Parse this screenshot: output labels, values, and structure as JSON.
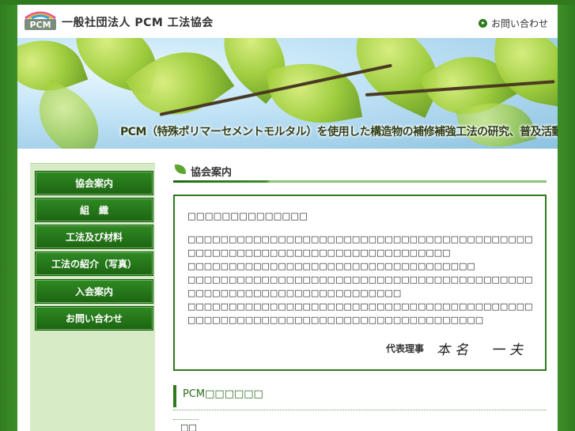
{
  "header": {
    "logo_text": "PCM",
    "site_title": "一般社団法人 PCM 工法協会",
    "contact_label": "お問い合わせ"
  },
  "banner": {
    "tagline": "PCM（特殊ポリマーセメントモルタル）を使用した構造物の補修補強工法の研究、普及活動"
  },
  "sidebar": {
    "items": [
      {
        "label": "協会案内"
      },
      {
        "label": "組　織"
      },
      {
        "label": "工法及び材料"
      },
      {
        "label": "工法の紹介（写真）"
      },
      {
        "label": "入会案内"
      },
      {
        "label": "お問い合わせ"
      }
    ]
  },
  "main": {
    "heading": "協会案内",
    "greeting_title": "□□□□□□□□□□□□□□",
    "paragraphs": [
      "□□□□□□□□□□□□□□□□□□□□□□□□□□□□□□□□□□□□□□□□□□□□□□□□□□□□□□□□□□□□□□□□□□□□□□□□□□",
      "□□□□□□□□□□□□□□□□□□□□□□□□□□□□□□□□□□□",
      "□□□□□□□□□□□□□□□□□□□□□□□□□□□□□□□□□□□□□□□□□□□□□□□□□□□□□□□□□□□□□□□□□□□□",
      "□□□□□□□□□□□□□□□□□□□□□□□□□□□□□□□□□□□□□□□□□□□□□□□□□□□□□□□□□□□□□□□□□□□□□□□□□□□□□□"
    ],
    "signature_role": "代表理事",
    "signature_name": "本名　一夫",
    "pcm_heading": "PCM□□□□□□",
    "news_item": "□□"
  },
  "colors": {
    "accent": "#2e7a1d",
    "sidebar_bg": "#d7ebc6"
  }
}
